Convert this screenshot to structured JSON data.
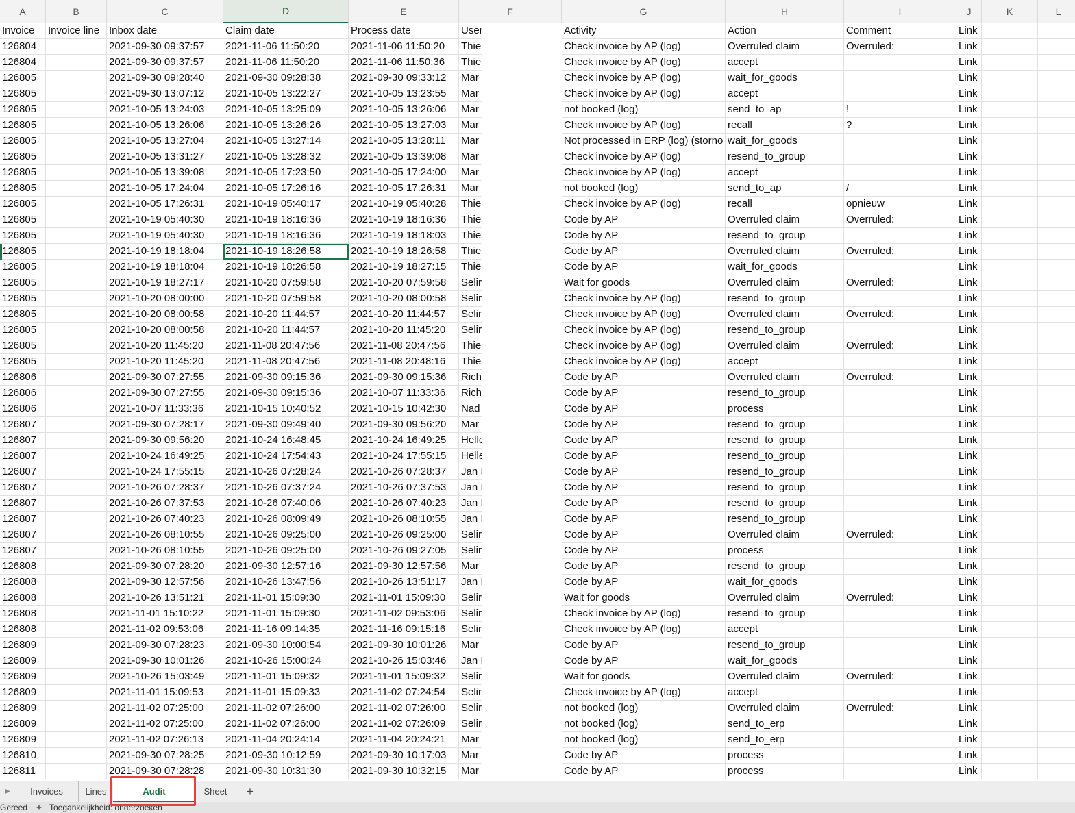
{
  "columns": [
    "A",
    "B",
    "C",
    "D",
    "E",
    "F",
    "G",
    "H",
    "I",
    "J",
    "K",
    "L"
  ],
  "selected_column": "D",
  "headers": [
    "Invoice",
    "Invoice line",
    "Inbox date",
    "Claim date",
    "Process date",
    "User",
    "Activity",
    "Action",
    "Comment",
    "Link"
  ],
  "rows": [
    [
      "126804",
      "",
      "2021-09-30 09:37:57",
      "2021-11-06 11:50:20",
      "2021-11-06 11:50:20",
      "Thie",
      "Check invoice by AP (log)",
      "Overruled claim",
      "Overruled:",
      "Link"
    ],
    [
      "126804",
      "",
      "2021-09-30 09:37:57",
      "2021-11-06 11:50:20",
      "2021-11-06 11:50:36",
      "Thie",
      "Check invoice by AP (log)",
      "accept",
      "",
      "Link"
    ],
    [
      "126805",
      "",
      "2021-09-30 09:28:40",
      "2021-09-30 09:28:38",
      "2021-09-30 09:33:12",
      "Mar",
      "Check invoice by AP (log)",
      "wait_for_goods",
      "",
      "Link"
    ],
    [
      "126805",
      "",
      "2021-09-30 13:07:12",
      "2021-10-05 13:22:27",
      "2021-10-05 13:23:55",
      "Mar",
      "Check invoice by AP (log)",
      "accept",
      "",
      "Link"
    ],
    [
      "126805",
      "",
      "2021-10-05 13:24:03",
      "2021-10-05 13:25:09",
      "2021-10-05 13:26:06",
      "Mar",
      "not booked (log)",
      "send_to_ap",
      "!",
      "Link"
    ],
    [
      "126805",
      "",
      "2021-10-05 13:26:06",
      "2021-10-05 13:26:26",
      "2021-10-05 13:27:03",
      "Mar",
      "Check invoice by AP (log)",
      "recall",
      "?",
      "Link"
    ],
    [
      "126805",
      "",
      "2021-10-05 13:27:04",
      "2021-10-05 13:27:14",
      "2021-10-05 13:28:11",
      "Mar",
      "Not processed in ERP (log) (storno",
      "wait_for_goods",
      "",
      "Link"
    ],
    [
      "126805",
      "",
      "2021-10-05 13:31:27",
      "2021-10-05 13:28:32",
      "2021-10-05 13:39:08",
      "Mar",
      "Check invoice by AP (log)",
      "resend_to_group",
      "",
      "Link"
    ],
    [
      "126805",
      "",
      "2021-10-05 13:39:08",
      "2021-10-05 17:23:50",
      "2021-10-05 17:24:00",
      "Mar",
      "Check invoice by AP (log)",
      "accept",
      "",
      "Link"
    ],
    [
      "126805",
      "",
      "2021-10-05 17:24:04",
      "2021-10-05 17:26:16",
      "2021-10-05 17:26:31",
      "Mar",
      "not booked (log)",
      "send_to_ap",
      "/",
      "Link"
    ],
    [
      "126805",
      "",
      "2021-10-05 17:26:31",
      "2021-10-19 05:40:17",
      "2021-10-19 05:40:28",
      "Thie",
      "Check invoice by AP (log)",
      "recall",
      "opnieuw",
      "Link"
    ],
    [
      "126805",
      "",
      "2021-10-19 05:40:30",
      "2021-10-19 18:16:36",
      "2021-10-19 18:16:36",
      "Thie",
      "Code by AP",
      "Overruled claim",
      "Overruled:",
      "Link"
    ],
    [
      "126805",
      "",
      "2021-10-19 05:40:30",
      "2021-10-19 18:16:36",
      "2021-10-19 18:18:03",
      "Thie",
      "Code by AP",
      "resend_to_group",
      "",
      "Link"
    ],
    [
      "126805",
      "",
      "2021-10-19 18:18:04",
      "2021-10-19 18:26:58",
      "2021-10-19 18:26:58",
      "Thie",
      "Code by AP",
      "Overruled claim",
      "Overruled:",
      "Link"
    ],
    [
      "126805",
      "",
      "2021-10-19 18:18:04",
      "2021-10-19 18:26:58",
      "2021-10-19 18:27:15",
      "Thie",
      "Code by AP",
      "wait_for_goods",
      "",
      "Link"
    ],
    [
      "126805",
      "",
      "2021-10-19 18:27:17",
      "2021-10-20 07:59:58",
      "2021-10-20 07:59:58",
      "Selir",
      "Wait for goods",
      "Overruled claim",
      "Overruled:",
      "Link"
    ],
    [
      "126805",
      "",
      "2021-10-20 08:00:00",
      "2021-10-20 07:59:58",
      "2021-10-20 08:00:58",
      "Selir",
      "Check invoice by AP (log)",
      "resend_to_group",
      "",
      "Link"
    ],
    [
      "126805",
      "",
      "2021-10-20 08:00:58",
      "2021-10-20 11:44:57",
      "2021-10-20 11:44:57",
      "Selir",
      "Check invoice by AP (log)",
      "Overruled claim",
      "Overruled:",
      "Link"
    ],
    [
      "126805",
      "",
      "2021-10-20 08:00:58",
      "2021-10-20 11:44:57",
      "2021-10-20 11:45:20",
      "Selir",
      "Check invoice by AP (log)",
      "resend_to_group",
      "",
      "Link"
    ],
    [
      "126805",
      "",
      "2021-10-20 11:45:20",
      "2021-11-08 20:47:56",
      "2021-11-08 20:47:56",
      "Thie",
      "Check invoice by AP (log)",
      "Overruled claim",
      "Overruled:",
      "Link"
    ],
    [
      "126805",
      "",
      "2021-10-20 11:45:20",
      "2021-11-08 20:47:56",
      "2021-11-08 20:48:16",
      "Thie",
      "Check invoice by AP (log)",
      "accept",
      "",
      "Link"
    ],
    [
      "126806",
      "",
      "2021-09-30 07:27:55",
      "2021-09-30 09:15:36",
      "2021-09-30 09:15:36",
      "Rich",
      "Code by AP",
      "Overruled claim",
      "Overruled:",
      "Link"
    ],
    [
      "126806",
      "",
      "2021-09-30 07:27:55",
      "2021-09-30 09:15:36",
      "2021-10-07 11:33:36",
      "Rich",
      "Code by AP",
      "resend_to_group",
      "",
      "Link"
    ],
    [
      "126806",
      "",
      "2021-10-07 11:33:36",
      "2021-10-15 10:40:52",
      "2021-10-15 10:42:30",
      "Nad",
      "Code by AP",
      "process",
      "",
      "Link"
    ],
    [
      "126807",
      "",
      "2021-09-30 07:28:17",
      "2021-09-30 09:49:40",
      "2021-09-30 09:56:20",
      "Mar",
      "Code by AP",
      "resend_to_group",
      "",
      "Link"
    ],
    [
      "126807",
      "",
      "2021-09-30 09:56:20",
      "2021-10-24 16:48:45",
      "2021-10-24 16:49:25",
      "Helle",
      "Code by AP",
      "resend_to_group",
      "",
      "Link"
    ],
    [
      "126807",
      "",
      "2021-10-24 16:49:25",
      "2021-10-24 17:54:43",
      "2021-10-24 17:55:15",
      "Helle",
      "Code by AP",
      "resend_to_group",
      "",
      "Link"
    ],
    [
      "126807",
      "",
      "2021-10-24 17:55:15",
      "2021-10-26 07:28:24",
      "2021-10-26 07:28:37",
      "Jan I",
      "Code by AP",
      "resend_to_group",
      "",
      "Link"
    ],
    [
      "126807",
      "",
      "2021-10-26 07:28:37",
      "2021-10-26 07:37:24",
      "2021-10-26 07:37:53",
      "Jan I",
      "Code by AP",
      "resend_to_group",
      "",
      "Link"
    ],
    [
      "126807",
      "",
      "2021-10-26 07:37:53",
      "2021-10-26 07:40:06",
      "2021-10-26 07:40:23",
      "Jan I",
      "Code by AP",
      "resend_to_group",
      "",
      "Link"
    ],
    [
      "126807",
      "",
      "2021-10-26 07:40:23",
      "2021-10-26 08:09:49",
      "2021-10-26 08:10:55",
      "Jan I",
      "Code by AP",
      "resend_to_group",
      "",
      "Link"
    ],
    [
      "126807",
      "",
      "2021-10-26 08:10:55",
      "2021-10-26 09:25:00",
      "2021-10-26 09:25:00",
      "Selir",
      "Code by AP",
      "Overruled claim",
      "Overruled:",
      "Link"
    ],
    [
      "126807",
      "",
      "2021-10-26 08:10:55",
      "2021-10-26 09:25:00",
      "2021-10-26 09:27:05",
      "Selir",
      "Code by AP",
      "process",
      "",
      "Link"
    ],
    [
      "126808",
      "",
      "2021-09-30 07:28:20",
      "2021-09-30 12:57:16",
      "2021-09-30 12:57:56",
      "Mar",
      "Code by AP",
      "resend_to_group",
      "",
      "Link"
    ],
    [
      "126808",
      "",
      "2021-09-30 12:57:56",
      "2021-10-26 13:47:56",
      "2021-10-26 13:51:17",
      "Jan I",
      "Code by AP",
      "wait_for_goods",
      "",
      "Link"
    ],
    [
      "126808",
      "",
      "2021-10-26 13:51:21",
      "2021-11-01 15:09:30",
      "2021-11-01 15:09:30",
      "Selir",
      "Wait for goods",
      "Overruled claim",
      "Overruled:",
      "Link"
    ],
    [
      "126808",
      "",
      "2021-11-01 15:10:22",
      "2021-11-01 15:09:30",
      "2021-11-02 09:53:06",
      "Selir",
      "Check invoice by AP (log)",
      "resend_to_group",
      "",
      "Link"
    ],
    [
      "126808",
      "",
      "2021-11-02 09:53:06",
      "2021-11-16 09:14:35",
      "2021-11-16 09:15:16",
      "Selir",
      "Check invoice by AP (log)",
      "accept",
      "",
      "Link"
    ],
    [
      "126809",
      "",
      "2021-09-30 07:28:23",
      "2021-09-30 10:00:54",
      "2021-09-30 10:01:26",
      "Mar",
      "Code by AP",
      "resend_to_group",
      "",
      "Link"
    ],
    [
      "126809",
      "",
      "2021-09-30 10:01:26",
      "2021-10-26 15:00:24",
      "2021-10-26 15:03:46",
      "Jan I",
      "Code by AP",
      "wait_for_goods",
      "",
      "Link"
    ],
    [
      "126809",
      "",
      "2021-10-26 15:03:49",
      "2021-11-01 15:09:32",
      "2021-11-01 15:09:32",
      "Selir",
      "Wait for goods",
      "Overruled claim",
      "Overruled:",
      "Link"
    ],
    [
      "126809",
      "",
      "2021-11-01 15:09:53",
      "2021-11-01 15:09:33",
      "2021-11-02 07:24:54",
      "Selir",
      "Check invoice by AP (log)",
      "accept",
      "",
      "Link"
    ],
    [
      "126809",
      "",
      "2021-11-02 07:25:00",
      "2021-11-02 07:26:00",
      "2021-11-02 07:26:00",
      "Selir",
      "not booked (log)",
      "Overruled claim",
      "Overruled:",
      "Link"
    ],
    [
      "126809",
      "",
      "2021-11-02 07:25:00",
      "2021-11-02 07:26:00",
      "2021-11-02 07:26:09",
      "Selir",
      "not booked (log)",
      "send_to_erp",
      "",
      "Link"
    ],
    [
      "126809",
      "",
      "2021-11-02 07:26:13",
      "2021-11-04 20:24:14",
      "2021-11-04 20:24:21",
      "Mar",
      "not booked (log)",
      "send_to_erp",
      "",
      "Link"
    ],
    [
      "126810",
      "",
      "2021-09-30 07:28:25",
      "2021-09-30 10:12:59",
      "2021-09-30 10:17:03",
      "Mar",
      "Code by AP",
      "process",
      "",
      "Link"
    ],
    [
      "126811",
      "",
      "2021-09-30 07:28:28",
      "2021-09-30 10:31:30",
      "2021-09-30 10:32:15",
      "Mar",
      "Code by AP",
      "process",
      "",
      "Link"
    ]
  ],
  "active_cell": {
    "row": 13,
    "col": "D"
  },
  "sheet_tabs": [
    {
      "label": "Invoices",
      "active": false
    },
    {
      "label": "Lines",
      "active": false
    },
    {
      "label": "Audit",
      "active": true
    },
    {
      "label": "Sheet",
      "active": false
    }
  ],
  "add_sheet_label": "+",
  "status": {
    "ready": "Gereed",
    "accessibility": "Toegankelijkheid: onderzoeken"
  },
  "colors": {
    "accent": "#217346",
    "highlight": "#e8403a"
  }
}
